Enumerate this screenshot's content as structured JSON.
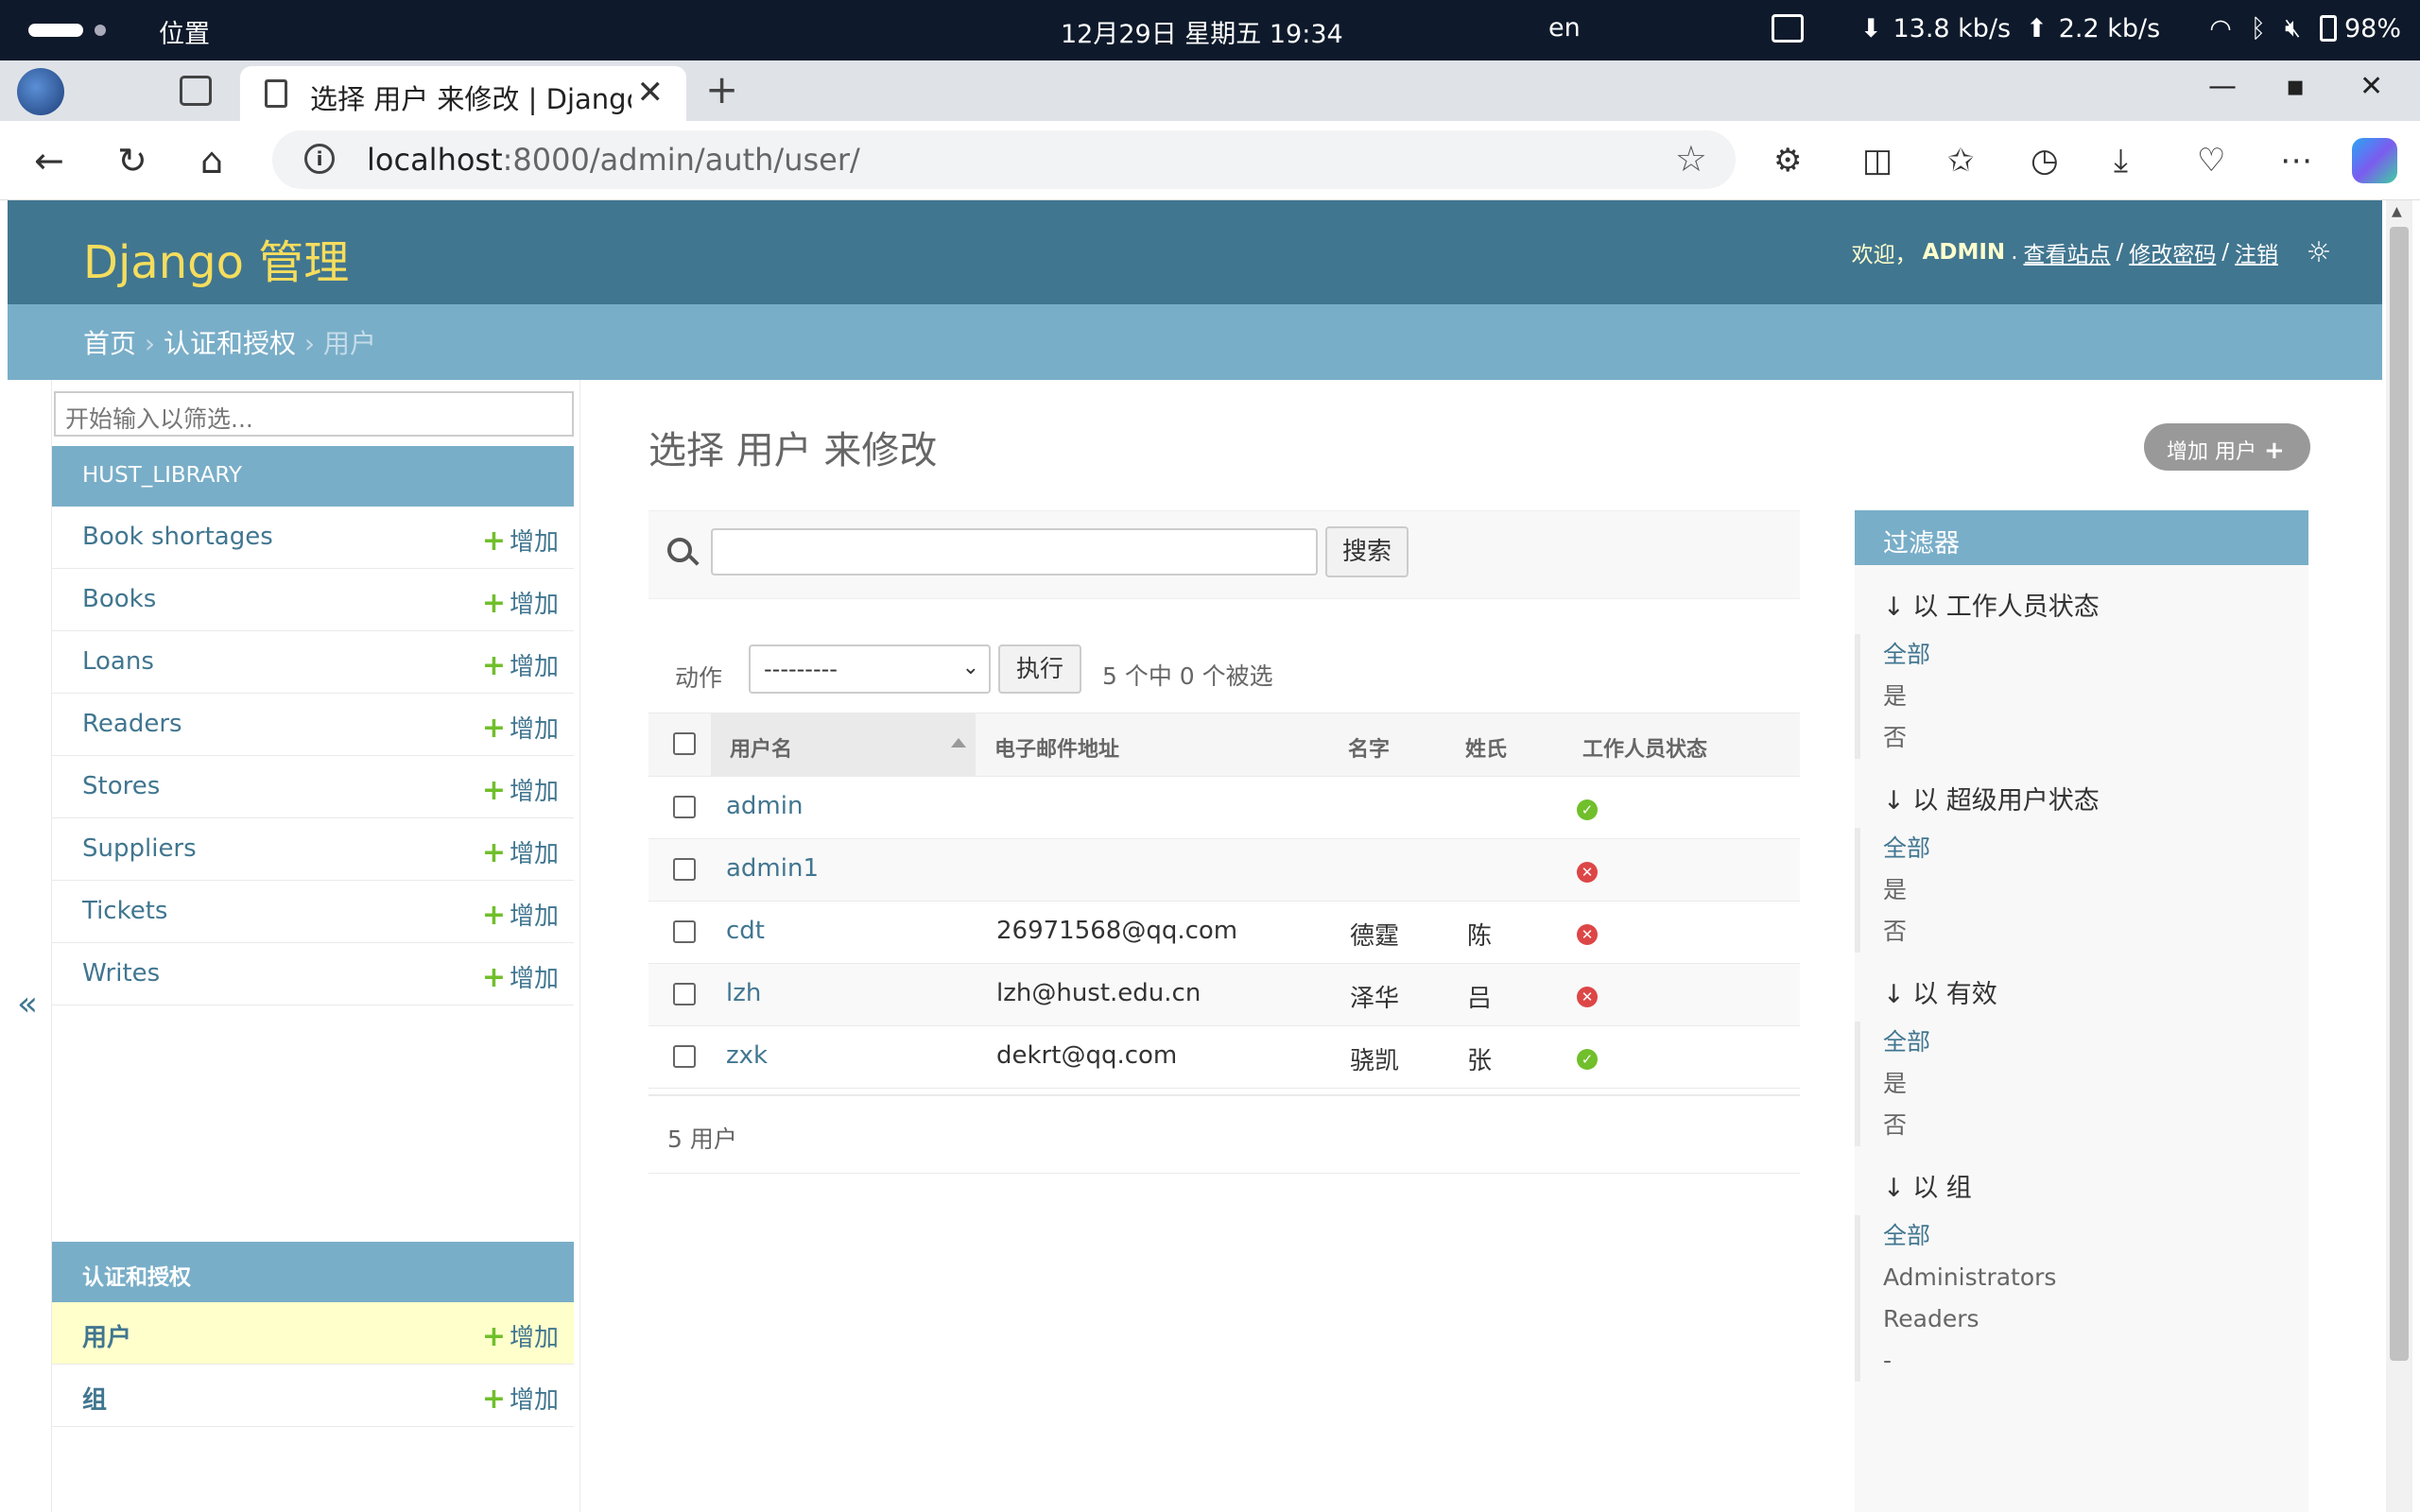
{
  "os": {
    "location": "位置",
    "clock": "12月29日 星期五 19:34",
    "lang": "en",
    "down_rate": "13.8 kb/s",
    "up_rate": "2.2 kb/s",
    "battery": "98%"
  },
  "browser": {
    "tab_title": "选择 用户 来修改 | Django",
    "url_host": "localhost",
    "url_rest": ":8000/admin/auth/user/"
  },
  "header": {
    "brand": "Django 管理",
    "welcome": "欢迎，",
    "user": "ADMIN",
    "view_site": "查看站点",
    "change_password": "修改密码",
    "logout": "注销"
  },
  "breadcrumbs": {
    "home": "首页",
    "app": "认证和授权",
    "current": "用户"
  },
  "sidebar": {
    "filter_placeholder": "开始输入以筛选...",
    "collapse": "«",
    "apps": [
      {
        "caption": "HUST_LIBRARY",
        "models": [
          {
            "name": "Book shortages",
            "add": "增加"
          },
          {
            "name": "Books",
            "add": "增加"
          },
          {
            "name": "Loans",
            "add": "增加"
          },
          {
            "name": "Readers",
            "add": "增加"
          },
          {
            "name": "Stores",
            "add": "增加"
          },
          {
            "name": "Suppliers",
            "add": "增加"
          },
          {
            "name": "Tickets",
            "add": "增加"
          },
          {
            "name": "Writes",
            "add": "增加"
          }
        ]
      },
      {
        "caption": "认证和授权",
        "models": [
          {
            "name": "用户",
            "add": "增加"
          },
          {
            "name": "组",
            "add": "增加"
          }
        ]
      }
    ]
  },
  "content": {
    "title": "选择 用户 来修改",
    "add_button": "增加 用户",
    "search_button": "搜索",
    "action_label": "动作",
    "action_selected": "---------",
    "go_button": "执行",
    "selection_count": "5 个中 0 个被选",
    "columns": [
      "用户名",
      "电子邮件地址",
      "名字",
      "姓氏",
      "工作人员状态"
    ],
    "rows": [
      {
        "username": "admin",
        "email": "",
        "first": "",
        "last": "",
        "staff": true
      },
      {
        "username": "admin1",
        "email": "",
        "first": "",
        "last": "",
        "staff": false
      },
      {
        "username": "cdt",
        "email": "26971568@qq.com",
        "first": "德霆",
        "last": "陈",
        "staff": false
      },
      {
        "username": "lzh",
        "email": "lzh@hust.edu.cn",
        "first": "泽华",
        "last": "吕",
        "staff": false
      },
      {
        "username": "zxk",
        "email": "dekrt@qq.com",
        "first": "骁凯",
        "last": "张",
        "staff": true
      }
    ],
    "footer": "5 用户"
  },
  "filters": {
    "caption": "过滤器",
    "groups": [
      {
        "title": "↓ 以 工作人员状态",
        "options": [
          "全部",
          "是",
          "否"
        ]
      },
      {
        "title": "↓ 以 超级用户状态",
        "options": [
          "全部",
          "是",
          "否"
        ]
      },
      {
        "title": "↓ 以 有效",
        "options": [
          "全部",
          "是",
          "否"
        ]
      },
      {
        "title": "↓ 以 组",
        "options": [
          "全部",
          "Administrators",
          "Readers",
          "-"
        ]
      }
    ]
  }
}
